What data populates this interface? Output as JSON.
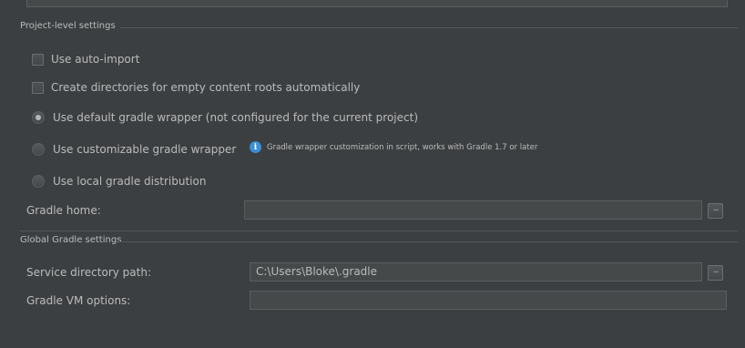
{
  "project_section": {
    "title": "Project-level settings",
    "use_auto_import": {
      "label": "Use auto-import",
      "checked": false
    },
    "create_dirs": {
      "label": "Create directories for empty content roots automatically",
      "checked": false
    },
    "wrapper_options": [
      {
        "label": "Use default gradle wrapper (not configured for the current project)",
        "selected": true
      },
      {
        "label": "Use customizable gradle wrapper",
        "selected": false
      },
      {
        "label": "Use local gradle distribution",
        "selected": false
      }
    ],
    "info_note": "Gradle wrapper customization in script, works with Gradle 1.7 or later",
    "gradle_home": {
      "label": "Gradle home:",
      "value": ""
    }
  },
  "global_section": {
    "title": "Global Gradle settings",
    "service_dir": {
      "label": "Service directory path:",
      "value": "C:\\Users\\Bloke\\.gradle"
    },
    "vm_options": {
      "label": "Gradle VM options:",
      "value": ""
    }
  },
  "browse_button_label": "...",
  "info_icon_glyph": "i",
  "colors": {
    "background": "#3c3f41",
    "field_background": "#45494a",
    "text": "#bbbbbb",
    "info_icon": "#3d8fd6"
  }
}
